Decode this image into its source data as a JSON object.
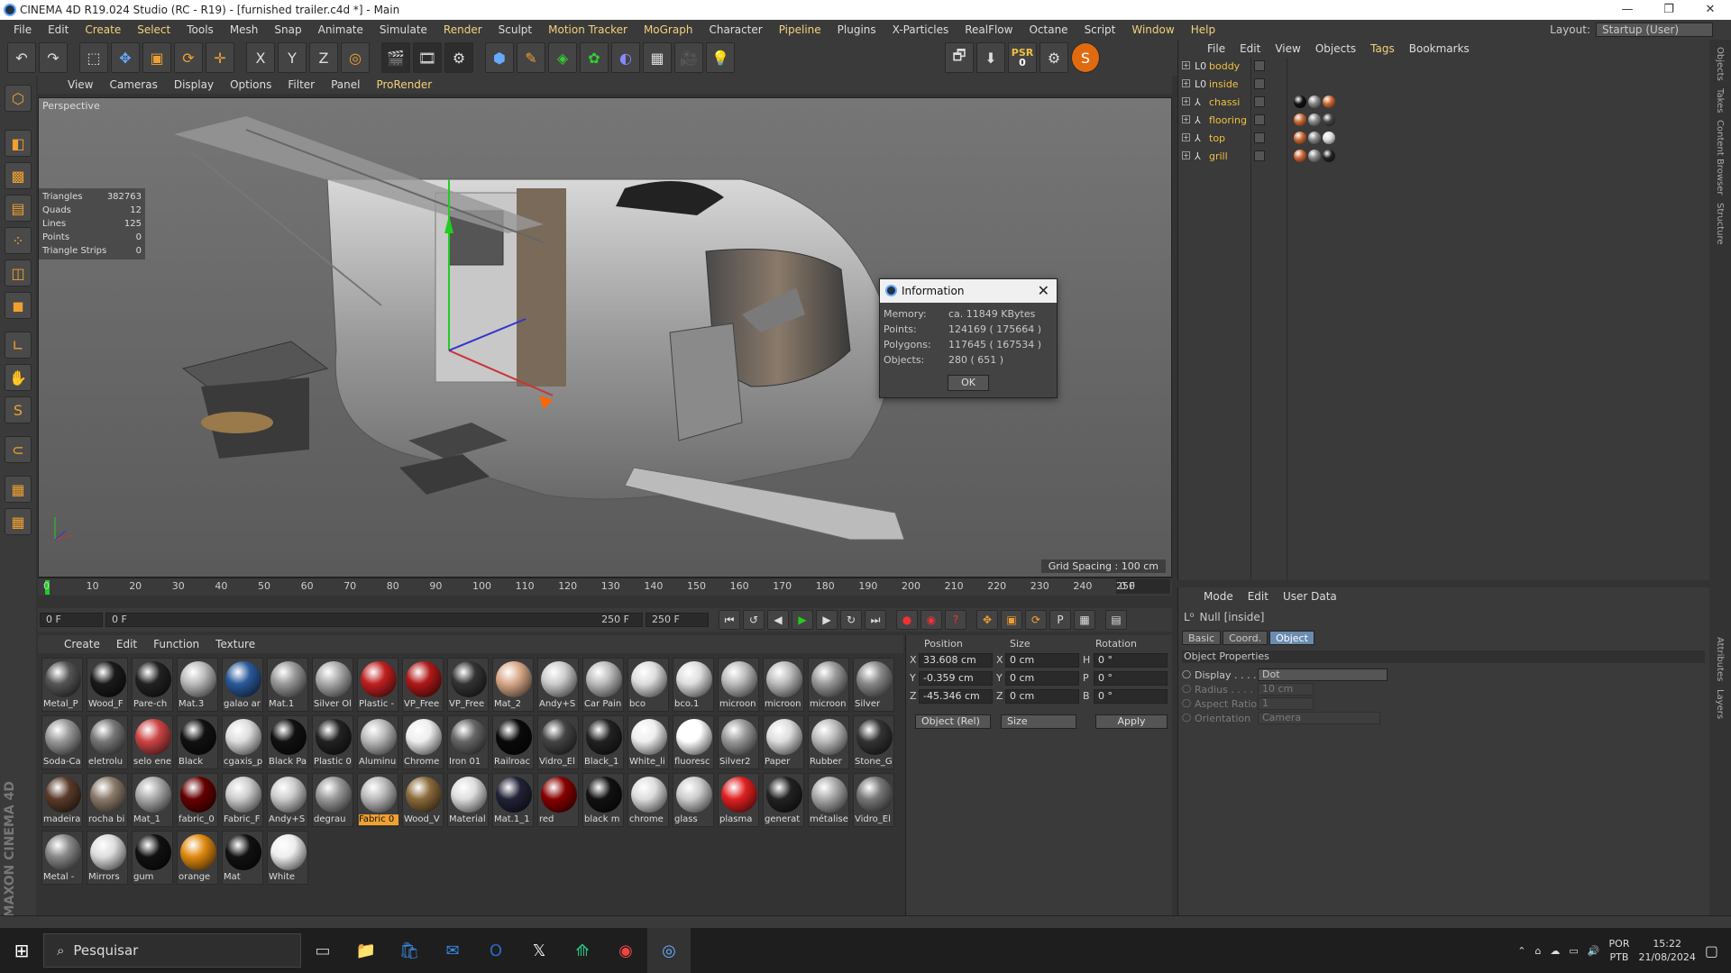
{
  "window": {
    "title": "CINEMA 4D R19.024 Studio (RC - R19) - [furnished trailer.c4d *] - Main"
  },
  "menubar": {
    "items": [
      "File",
      "Edit",
      "Create",
      "Select",
      "Tools",
      "Mesh",
      "Snap",
      "Animate",
      "Simulate",
      "Render",
      "Sculpt",
      "Motion Tracker",
      "MoGraph",
      "Character",
      "Pipeline",
      "Plugins",
      "X-Particles",
      "RealFlow",
      "Octane",
      "Script",
      "Window",
      "Help"
    ],
    "highlighted": [
      "Create",
      "Select",
      "Render",
      "Motion Tracker",
      "MoGraph",
      "Pipeline",
      "Window",
      "Help"
    ],
    "layout_label": "Layout:",
    "layout_value": "Startup (User)"
  },
  "toolbar": {
    "psr_label": "PSR",
    "psr_value": "0",
    "axis_x": "X",
    "axis_y": "Y",
    "axis_z": "Z"
  },
  "viewport": {
    "menu": [
      "View",
      "Cameras",
      "Display",
      "Options",
      "Filter",
      "Panel",
      "ProRender"
    ],
    "label": "Perspective",
    "stats": [
      {
        "k": "Triangles",
        "v": "382763"
      },
      {
        "k": "Quads",
        "v": "12"
      },
      {
        "k": "Lines",
        "v": "125"
      },
      {
        "k": "Points",
        "v": "0"
      },
      {
        "k": "Triangle Strips",
        "v": "0"
      }
    ],
    "grid_spacing": "Grid Spacing : 100 cm"
  },
  "dialog": {
    "title": "Information",
    "rows": [
      {
        "k": "Memory:",
        "v": "ca. 11849 KBytes"
      },
      {
        "k": "Points:",
        "v": "124169 ( 175664 )"
      },
      {
        "k": "Polygons:",
        "v": "117645 ( 167534 )"
      },
      {
        "k": "Objects:",
        "v": "280 ( 651 )"
      }
    ],
    "ok": "OK"
  },
  "timeline": {
    "ticks": [
      "0",
      "10",
      "20",
      "30",
      "40",
      "50",
      "60",
      "70",
      "80",
      "90",
      "100",
      "110",
      "120",
      "130",
      "140",
      "150",
      "160",
      "170",
      "180",
      "190",
      "200",
      "210",
      "220",
      "230",
      "240",
      "250"
    ],
    "frame": "0 F"
  },
  "transport": {
    "start": "0 F",
    "range_start": "0 F",
    "range_end": "250 F",
    "end": "250 F"
  },
  "materials": {
    "menu": [
      "Create",
      "Edit",
      "Function",
      "Texture"
    ],
    "items": [
      {
        "n": "Metal_P",
        "c": "#555"
      },
      {
        "n": "Wood_F",
        "c": "#1a1a1a"
      },
      {
        "n": "Pare-ch",
        "c": "#222"
      },
      {
        "n": "Mat.3",
        "c": "#bbb"
      },
      {
        "n": "galao ar",
        "c": "#2a5a9a"
      },
      {
        "n": "Mat.1",
        "c": "#999"
      },
      {
        "n": "Silver Ol",
        "c": "#aaa"
      },
      {
        "n": "Plastic -",
        "c": "#c02020"
      },
      {
        "n": "VP_Free",
        "c": "#b01818"
      },
      {
        "n": "VP_Free",
        "c": "#333"
      },
      {
        "n": "Mat_2",
        "c": "#d8a888"
      },
      {
        "n": "Andy+S",
        "c": "#ccc"
      },
      {
        "n": "Car Pain",
        "c": "#bbb"
      },
      {
        "n": "bco",
        "c": "#ddd"
      },
      {
        "n": "bco.1",
        "c": "#ddd"
      },
      {
        "n": "microon",
        "c": "#bbb"
      },
      {
        "n": "microon",
        "c": "#bbb"
      },
      {
        "n": "microon",
        "c": "#999"
      },
      {
        "n": "Silver",
        "c": "#888"
      },
      {
        "n": "Soda-Ca",
        "c": "#999"
      },
      {
        "n": "eletrolu",
        "c": "#777"
      },
      {
        "n": "selo ene",
        "c": "#c44"
      },
      {
        "n": "Black",
        "c": "#111"
      },
      {
        "n": "cgaxis_p",
        "c": "#ddd"
      },
      {
        "n": "Black Pa",
        "c": "#111"
      },
      {
        "n": "Plastic 0",
        "c": "#222"
      },
      {
        "n": "Aluminu",
        "c": "#bbb"
      },
      {
        "n": "Chrome",
        "c": "#eee"
      },
      {
        "n": "Iron 01",
        "c": "#666"
      },
      {
        "n": "Railroac",
        "c": "#0a0a0a"
      },
      {
        "n": "Vidro_El",
        "c": "#444"
      },
      {
        "n": "Black_1",
        "c": "#222"
      },
      {
        "n": "White_li",
        "c": "#eee"
      },
      {
        "n": "fluoresc",
        "c": "#fff"
      },
      {
        "n": "Silver2",
        "c": "#999"
      },
      {
        "n": "Paper",
        "c": "#ddd"
      },
      {
        "n": "Rubber",
        "c": "#bbb"
      },
      {
        "n": "Stone_G",
        "c": "#333"
      },
      {
        "n": "madeira",
        "c": "#5a3a2a"
      },
      {
        "n": "rocha bi",
        "c": "#8a7a6a"
      },
      {
        "n": "Mat_1",
        "c": "#aaa"
      },
      {
        "n": "fabric_0",
        "c": "#600"
      },
      {
        "n": "Fabric_F",
        "c": "#ccc"
      },
      {
        "n": "Andy+S",
        "c": "#ccc"
      },
      {
        "n": "degrau",
        "c": "#999"
      },
      {
        "n": "Fabric 0",
        "c": "#bbb"
      },
      {
        "n": "Wood_V",
        "c": "#8a6a3a"
      },
      {
        "n": "Material",
        "c": "#ddd"
      },
      {
        "n": "Mat.1_1",
        "c": "#222238"
      },
      {
        "n": "red",
        "c": "#800"
      },
      {
        "n": "black m",
        "c": "#111"
      },
      {
        "n": "chrome",
        "c": "#ddd"
      },
      {
        "n": "glass",
        "c": "#ccc"
      },
      {
        "n": "plasma",
        "c": "#e02020"
      },
      {
        "n": "generat",
        "c": "#222"
      },
      {
        "n": "métalise",
        "c": "#aaa"
      },
      {
        "n": "Vidro_El",
        "c": "#777"
      },
      {
        "n": "Metal -",
        "c": "#888"
      },
      {
        "n": "Mirrors",
        "c": "#ddd"
      },
      {
        "n": "gum",
        "c": "#111"
      },
      {
        "n": "orange",
        "c": "#e08a10"
      },
      {
        "n": "Mat",
        "c": "#111"
      },
      {
        "n": "White",
        "c": "#eee"
      }
    ],
    "selected_index": 45
  },
  "coords": {
    "h_position": "Position",
    "h_size": "Size",
    "h_rotation": "Rotation",
    "rows": [
      {
        "a": "X",
        "pos": "33.608 cm",
        "s": "X",
        "size": "0 cm",
        "r": "H",
        "rot": "0 °"
      },
      {
        "a": "Y",
        "pos": "-0.359 cm",
        "s": "Y",
        "size": "0 cm",
        "r": "P",
        "rot": "0 °"
      },
      {
        "a": "Z",
        "pos": "-45.346 cm",
        "s": "Z",
        "size": "0 cm",
        "r": "B",
        "rot": "0 °"
      }
    ],
    "mode": "Object (Rel)",
    "size_mode": "Size",
    "apply": "Apply"
  },
  "objects": {
    "menu": [
      "File",
      "Edit",
      "View",
      "Objects",
      "Tags",
      "Bookmarks"
    ],
    "items": [
      {
        "name": "boddy",
        "icon": "L0"
      },
      {
        "name": "inside",
        "icon": "L0"
      },
      {
        "name": "chassi",
        "icon": "⅄"
      },
      {
        "name": "flooring",
        "icon": "⅄"
      },
      {
        "name": "top",
        "icon": "⅄"
      },
      {
        "name": "grill",
        "icon": "⅄"
      }
    ]
  },
  "attributes": {
    "menu": [
      "Mode",
      "Edit",
      "User Data"
    ],
    "object_label": "Null [inside]",
    "tabs": [
      "Basic",
      "Coord.",
      "Object"
    ],
    "active_tab": "Object",
    "section": "Object Properties",
    "props": [
      {
        "k": "Display . . . .",
        "v": "Dot",
        "enabled": true
      },
      {
        "k": "Radius . . . .",
        "v": "10 cm",
        "enabled": false
      },
      {
        "k": "Aspect Ratio",
        "v": "1",
        "enabled": false
      },
      {
        "k": "Orientation",
        "v": "Camera",
        "enabled": false
      }
    ]
  },
  "sidetabs": [
    "Objects",
    "Takes",
    "Content Browser",
    "Structure"
  ],
  "sidetabs2": [
    "Attributes",
    "Layers"
  ],
  "maxon": "MAXON CINEMA 4D",
  "taskbar": {
    "search": "Pesquisar",
    "lang1": "POR",
    "lang2": "PTB",
    "time": "15:22",
    "date": "21/08/2024"
  },
  "colors": {
    "accent": "#f4d27a",
    "selected_tab": "#6a8cb0",
    "bg": "#3a3a3a"
  }
}
